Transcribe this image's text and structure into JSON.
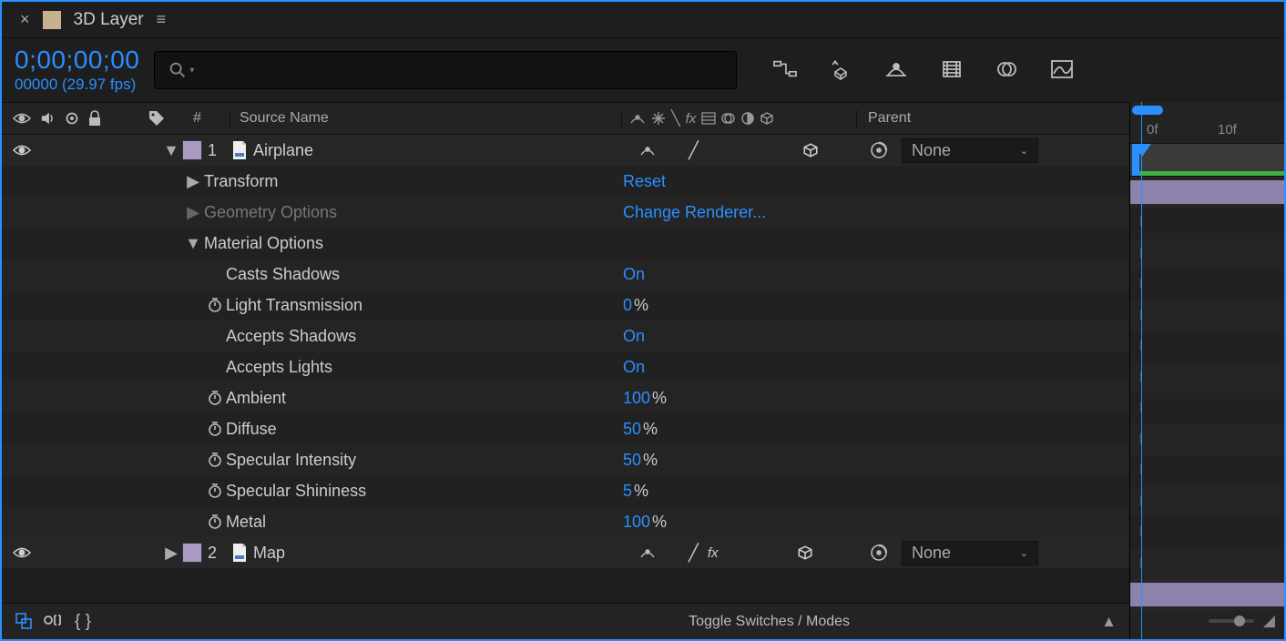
{
  "tab": {
    "title": "3D Layer"
  },
  "timecode": {
    "main": "0;00;00;00",
    "sub": "00000 (29.97 fps)"
  },
  "search": {
    "placeholder": ""
  },
  "columns": {
    "num": "#",
    "source": "Source Name",
    "parent": "Parent"
  },
  "layers": [
    {
      "index": "1",
      "name": "Airplane",
      "parent": "None",
      "groups": [
        {
          "name": "Transform",
          "value": "Reset",
          "expanded": false,
          "enabled": true
        },
        {
          "name": "Geometry Options",
          "value": "Change Renderer...",
          "expanded": false,
          "enabled": false
        },
        {
          "name": "Material Options",
          "expanded": true,
          "enabled": true,
          "props": [
            {
              "name": "Casts Shadows",
              "value": "On",
              "stopwatch": false
            },
            {
              "name": "Light Transmission",
              "value": "0",
              "pct": true,
              "stopwatch": true
            },
            {
              "name": "Accepts Shadows",
              "value": "On",
              "stopwatch": false
            },
            {
              "name": "Accepts Lights",
              "value": "On",
              "stopwatch": false
            },
            {
              "name": "Ambient",
              "value": "100",
              "pct": true,
              "stopwatch": true
            },
            {
              "name": "Diffuse",
              "value": "50",
              "pct": true,
              "stopwatch": true
            },
            {
              "name": "Specular Intensity",
              "value": "50",
              "pct": true,
              "stopwatch": true
            },
            {
              "name": "Specular Shininess",
              "value": "5",
              "pct": true,
              "stopwatch": true
            },
            {
              "name": "Metal",
              "value": "100",
              "pct": true,
              "stopwatch": true
            }
          ]
        }
      ]
    },
    {
      "index": "2",
      "name": "Map",
      "parent": "None",
      "collapsed": true
    }
  ],
  "timeline": {
    "ticks": [
      "0f",
      "10f"
    ]
  },
  "footer": {
    "toggle": "Toggle Switches / Modes"
  }
}
